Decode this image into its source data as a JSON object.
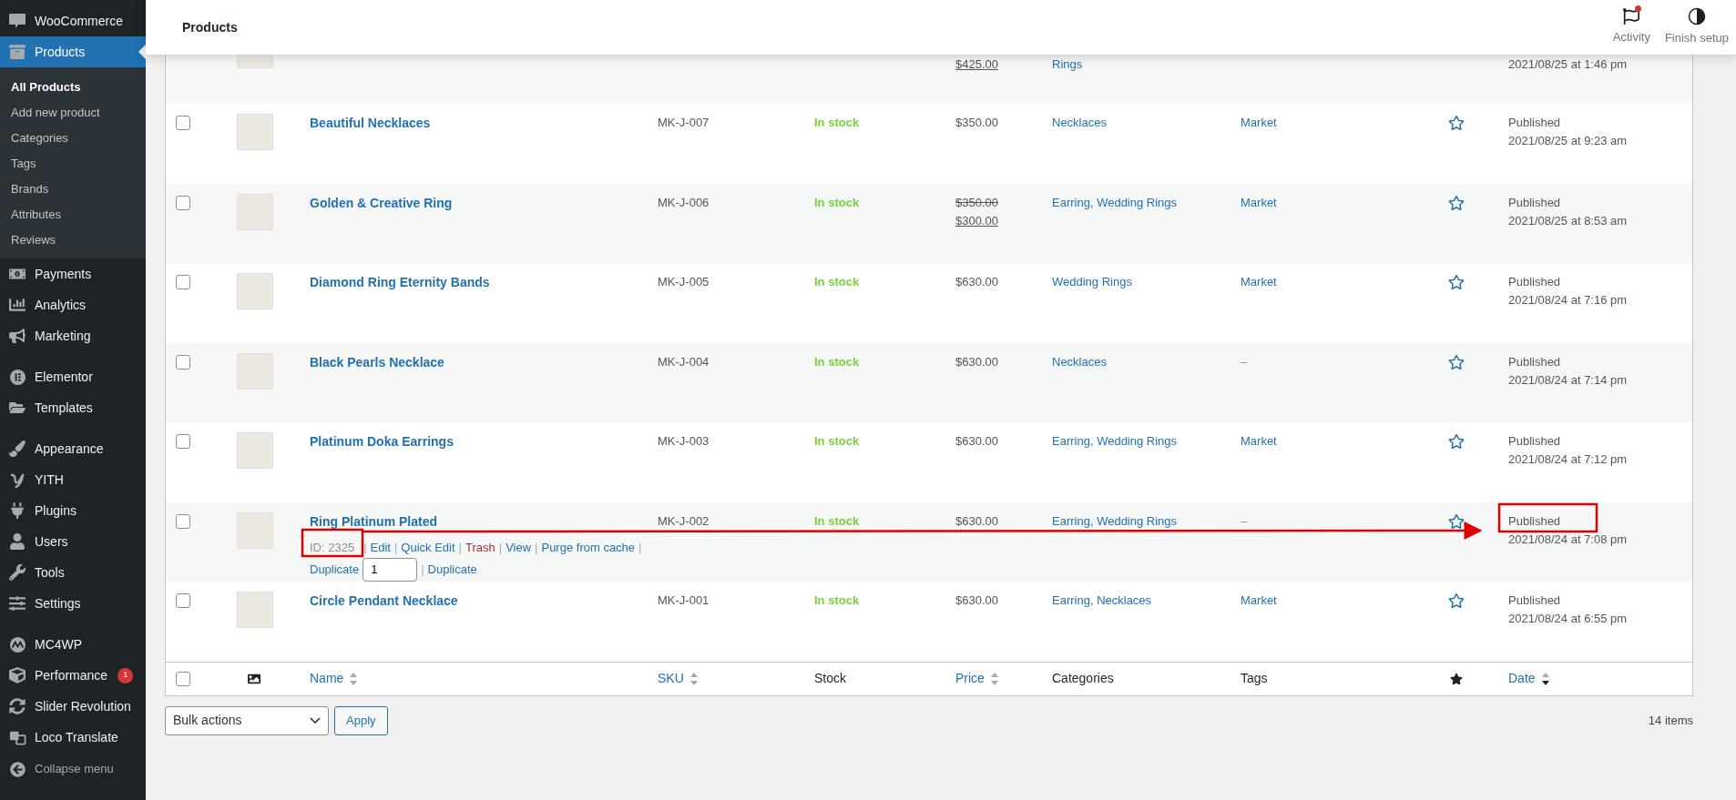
{
  "sidebar": {
    "groups": [
      {
        "items": [
          {
            "label": "WooCommerce",
            "selected": false
          },
          {
            "label": "Products",
            "selected": true,
            "submenu": [
              {
                "label": "All Products",
                "selected": true
              },
              {
                "label": "Add new product",
                "selected": false
              },
              {
                "label": "Categories",
                "selected": false
              },
              {
                "label": "Tags",
                "selected": false
              },
              {
                "label": "Brands",
                "selected": false
              },
              {
                "label": "Attributes",
                "selected": false
              },
              {
                "label": "Reviews",
                "selected": false
              }
            ]
          },
          {
            "label": "Payments",
            "selected": false
          },
          {
            "label": "Analytics",
            "selected": false
          },
          {
            "label": "Marketing",
            "selected": false
          }
        ]
      },
      {
        "items": [
          {
            "label": "Elementor",
            "selected": false
          },
          {
            "label": "Templates",
            "selected": false
          }
        ]
      },
      {
        "items": [
          {
            "label": "Appearance",
            "selected": false
          },
          {
            "label": "YITH",
            "selected": false
          },
          {
            "label": "Plugins",
            "selected": false
          },
          {
            "label": "Users",
            "selected": false
          },
          {
            "label": "Tools",
            "selected": false
          },
          {
            "label": "Settings",
            "selected": false
          }
        ]
      },
      {
        "items": [
          {
            "label": "MC4WP",
            "selected": false
          },
          {
            "label": "Performance",
            "selected": false,
            "badge": "1"
          },
          {
            "label": "Slider Revolution",
            "selected": false
          },
          {
            "label": "Loco Translate",
            "selected": false
          }
        ]
      }
    ],
    "collapse": "Collapse menu"
  },
  "header": {
    "title": "Products",
    "actions": [
      {
        "label": "Activity",
        "notification": true
      },
      {
        "label": "Finish setup",
        "notification": false
      }
    ]
  },
  "table": {
    "rows": [
      {
        "sale_price": "$425.00",
        "categories": "Rings",
        "date": "2021/08/25 at 1:46 pm"
      },
      {
        "checked": false,
        "name": "Beautiful Necklaces",
        "sku": "MK-J-007",
        "stock": "In stock",
        "price": "$350.00",
        "categories": "Necklaces",
        "tags": "Market",
        "tags_link": true,
        "featured": false,
        "status": "Published",
        "date": "2021/08/25 at 9:23 am"
      },
      {
        "checked": false,
        "name": "Golden & Creative Ring",
        "sku": "MK-J-006",
        "stock": "In stock",
        "price": "$350.00",
        "sale_price": "$300.00",
        "categories": "Earring, Wedding Rings",
        "tags": "Market",
        "tags_link": true,
        "featured": false,
        "status": "Published",
        "date": "2021/08/25 at 8:53 am"
      },
      {
        "checked": false,
        "name": "Diamond Ring Eternity Bands",
        "sku": "MK-J-005",
        "stock": "In stock",
        "price": "$630.00",
        "categories": "Wedding Rings",
        "tags": "Market",
        "tags_link": true,
        "featured": false,
        "status": "Published",
        "date": "2021/08/24 at 7:16 pm"
      },
      {
        "checked": false,
        "name": "Black Pearls Necklace",
        "sku": "MK-J-004",
        "stock": "In stock",
        "price": "$630.00",
        "categories": "Necklaces",
        "tags": "–",
        "tags_link": false,
        "featured": false,
        "status": "Published",
        "date": "2021/08/24 at 7:14 pm"
      },
      {
        "checked": false,
        "name": "Platinum Doka Earrings",
        "sku": "MK-J-003",
        "stock": "In stock",
        "price": "$630.00",
        "categories": "Earring, Wedding Rings",
        "tags": "Market",
        "tags_link": true,
        "featured": false,
        "status": "Published",
        "date": "2021/08/24 at 7:12 pm"
      },
      {
        "checked": false,
        "name": "Ring Platinum Plated",
        "sku": "MK-J-002",
        "stock": "In stock",
        "price": "$630.00",
        "categories": "Earring, Wedding Rings",
        "tags": "–",
        "tags_link": false,
        "featured": false,
        "status": "Published",
        "date": "2021/08/24 at 7:08 pm",
        "row_actions": [
          {
            "items": [
              {
                "kind": "id",
                "text": "ID: 2325"
              },
              {
                "kind": "separator",
                "text": "|"
              },
              {
                "kind": "link",
                "text": "Edit"
              },
              {
                "kind": "separator",
                "text": "|"
              },
              {
                "kind": "link",
                "text": "Quick Edit"
              },
              {
                "kind": "separator",
                "text": "|"
              },
              {
                "kind": "danger",
                "text": "Trash"
              },
              {
                "kind": "separator",
                "text": "|"
              },
              {
                "kind": "link",
                "text": "View"
              },
              {
                "kind": "separator",
                "text": "|"
              },
              {
                "kind": "link",
                "text": "Purge from cache"
              },
              {
                "kind": "separator",
                "text": "|"
              }
            ]
          },
          {
            "items": [
              {
                "kind": "link",
                "text": "Duplicate"
              },
              {
                "kind": "input",
                "text": "1"
              },
              {
                "kind": "separator",
                "text": "|"
              },
              {
                "kind": "link",
                "text": "Duplicate"
              }
            ]
          }
        ]
      },
      {
        "checked": false,
        "name": "Circle Pendant Necklace",
        "sku": "MK-J-001",
        "stock": "In stock",
        "price": "$630.00",
        "categories": "Earring, Necklaces",
        "tags": "Market",
        "tags_link": true,
        "featured": false,
        "status": "Published",
        "date": "2021/08/24 at 6:55 pm"
      }
    ],
    "footer": {
      "checked": false,
      "columns": [
        {
          "label": "Name",
          "sortable": true,
          "sorted": false
        },
        {
          "label": "SKU",
          "sortable": true,
          "sorted": false
        },
        {
          "label": "Stock",
          "sortable": false,
          "sorted": false
        },
        {
          "label": "Price",
          "sortable": true,
          "sorted": false
        },
        {
          "label": "Categories",
          "sortable": false,
          "sorted": false
        },
        {
          "label": "Tags",
          "sortable": false,
          "sorted": false
        },
        {
          "label": "Date",
          "sortable": true,
          "sorted": true
        }
      ]
    }
  },
  "bulk": {
    "select": "Bulk actions",
    "apply": "Apply",
    "count": "14 items"
  }
}
